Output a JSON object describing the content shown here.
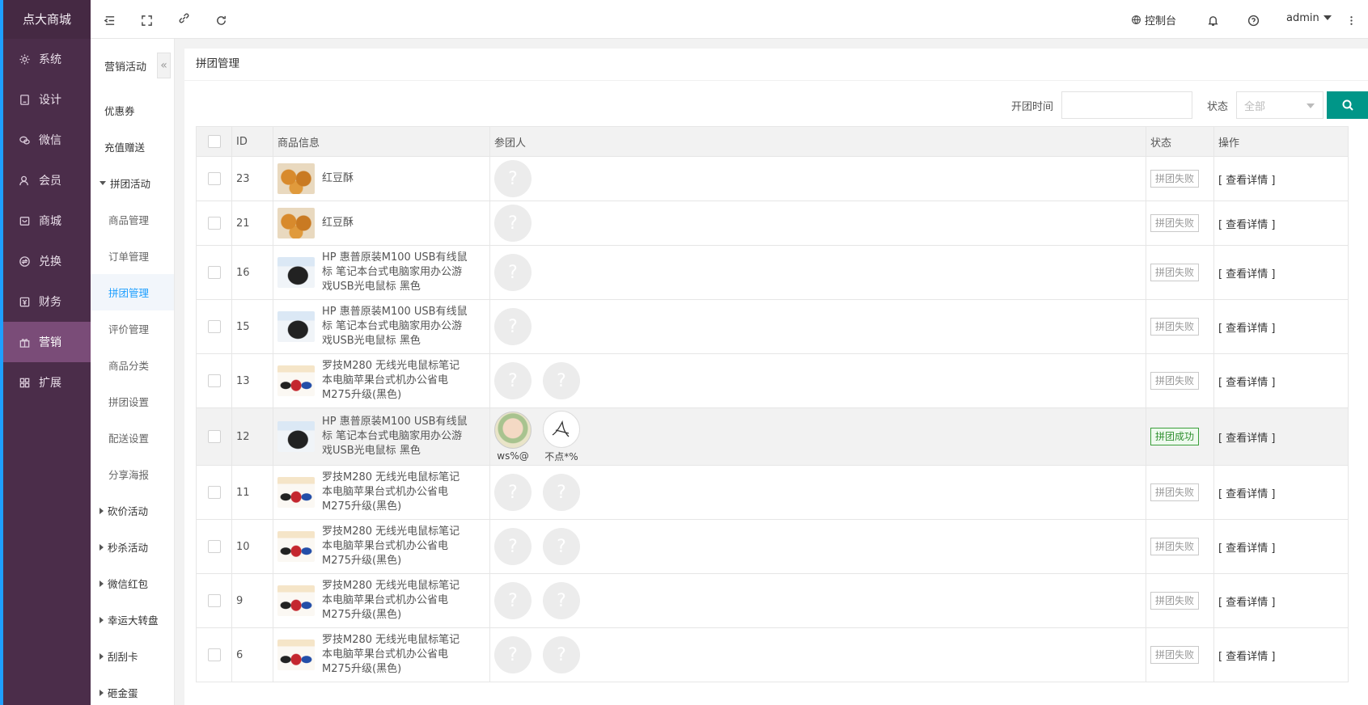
{
  "brand": "点大商城",
  "nav": [
    {
      "label": "系统",
      "icon": "gear-icon"
    },
    {
      "label": "设计",
      "icon": "design-icon"
    },
    {
      "label": "微信",
      "icon": "wechat-icon"
    },
    {
      "label": "会员",
      "icon": "member-icon"
    },
    {
      "label": "商城",
      "icon": "shop-icon"
    },
    {
      "label": "兑换",
      "icon": "exchange-icon"
    },
    {
      "label": "财务",
      "icon": "finance-icon"
    },
    {
      "label": "营销",
      "icon": "gift-icon"
    },
    {
      "label": "扩展",
      "icon": "grid-icon"
    }
  ],
  "header": {
    "console_label": "控制台",
    "user": "admin"
  },
  "subnav": {
    "title": "营销活动",
    "collapse_glyph": "«",
    "items": [
      {
        "label": "优惠券",
        "type": "top"
      },
      {
        "label": "充值赠送",
        "type": "top"
      },
      {
        "label": "拼团活动",
        "type": "group-open"
      },
      {
        "label": "商品管理",
        "type": "child"
      },
      {
        "label": "订单管理",
        "type": "child"
      },
      {
        "label": "拼团管理",
        "type": "child-active"
      },
      {
        "label": "评价管理",
        "type": "child"
      },
      {
        "label": "商品分类",
        "type": "child"
      },
      {
        "label": "拼团设置",
        "type": "child"
      },
      {
        "label": "配送设置",
        "type": "child"
      },
      {
        "label": "分享海报",
        "type": "child"
      },
      {
        "label": "砍价活动",
        "type": "group"
      },
      {
        "label": "秒杀活动",
        "type": "group"
      },
      {
        "label": "微信红包",
        "type": "group"
      },
      {
        "label": "幸运大转盘",
        "type": "group"
      },
      {
        "label": "刮刮卡",
        "type": "group"
      },
      {
        "label": "砸金蛋",
        "type": "group"
      }
    ]
  },
  "page": {
    "title": "拼团管理",
    "filter": {
      "time_label": "开团时间",
      "time_value": "",
      "status_label": "状态",
      "status_selected": "全部"
    },
    "table": {
      "columns": [
        "ID",
        "商品信息",
        "参团人",
        "状态",
        "操作"
      ],
      "action_label": "[ 查看详情 ]",
      "rows": [
        {
          "id": "23",
          "goods": "红豆酥",
          "thumb": "food",
          "participants": [
            {
              "placeholder": "?"
            }
          ],
          "status": "拼团失败",
          "ok": false
        },
        {
          "id": "21",
          "goods": "红豆酥",
          "thumb": "food",
          "participants": [
            {
              "placeholder": "?"
            }
          ],
          "status": "拼团失败",
          "ok": false
        },
        {
          "id": "16",
          "goods": "HP 惠普原装M100 USB有线鼠标 笔记本台式电脑家用办公游戏USB光电鼠标 黑色",
          "thumb": "mouse-hp",
          "participants": [
            {
              "placeholder": "?"
            }
          ],
          "status": "拼团失败",
          "ok": false
        },
        {
          "id": "15",
          "goods": "HP 惠普原装M100 USB有线鼠标 笔记本台式电脑家用办公游戏USB光电鼠标 黑色",
          "thumb": "mouse-hp",
          "participants": [
            {
              "placeholder": "?"
            }
          ],
          "status": "拼团失败",
          "ok": false
        },
        {
          "id": "13",
          "goods": "罗技M280 无线光电鼠标笔记本电脑苹果台式机办公省电M275升级(黑色)",
          "thumb": "mouse-lg",
          "participants": [
            {
              "placeholder": "?"
            },
            {
              "placeholder": "?"
            }
          ],
          "status": "拼团失败",
          "ok": false
        },
        {
          "id": "12",
          "goods": "HP 惠普原装M100 USB有线鼠标 笔记本台式电脑家用办公游戏USB光电鼠标 黑色",
          "thumb": "mouse-hp",
          "participants": [
            {
              "name": "ws%@",
              "avatar": "real1"
            },
            {
              "name": "不点*%",
              "avatar": "real2"
            }
          ],
          "status": "拼团成功",
          "ok": true
        },
        {
          "id": "11",
          "goods": "罗技M280 无线光电鼠标笔记本电脑苹果台式机办公省电M275升级(黑色)",
          "thumb": "mouse-lg",
          "participants": [
            {
              "placeholder": "?"
            },
            {
              "placeholder": "?"
            }
          ],
          "status": "拼团失败",
          "ok": false
        },
        {
          "id": "10",
          "goods": "罗技M280 无线光电鼠标笔记本电脑苹果台式机办公省电M275升级(黑色)",
          "thumb": "mouse-lg",
          "participants": [
            {
              "placeholder": "?"
            },
            {
              "placeholder": "?"
            }
          ],
          "status": "拼团失败",
          "ok": false
        },
        {
          "id": "9",
          "goods": "罗技M280 无线光电鼠标笔记本电脑苹果台式机办公省电M275升级(黑色)",
          "thumb": "mouse-lg",
          "participants": [
            {
              "placeholder": "?"
            },
            {
              "placeholder": "?"
            }
          ],
          "status": "拼团失败",
          "ok": false
        },
        {
          "id": "6",
          "goods": "罗技M280 无线光电鼠标笔记本电脑苹果台式机办公省电M275升级(黑色)",
          "thumb": "mouse-lg",
          "participants": [
            {
              "placeholder": "?"
            },
            {
              "placeholder": "?"
            }
          ],
          "status": "拼团失败",
          "ok": false
        }
      ]
    }
  },
  "colors": {
    "sidebar_bg": "#4b2d4a",
    "sidebar_active": "#7a4c78",
    "accent_blue": "#1e9fff",
    "search_btn": "#009688",
    "success_green": "#2f8f2f"
  }
}
